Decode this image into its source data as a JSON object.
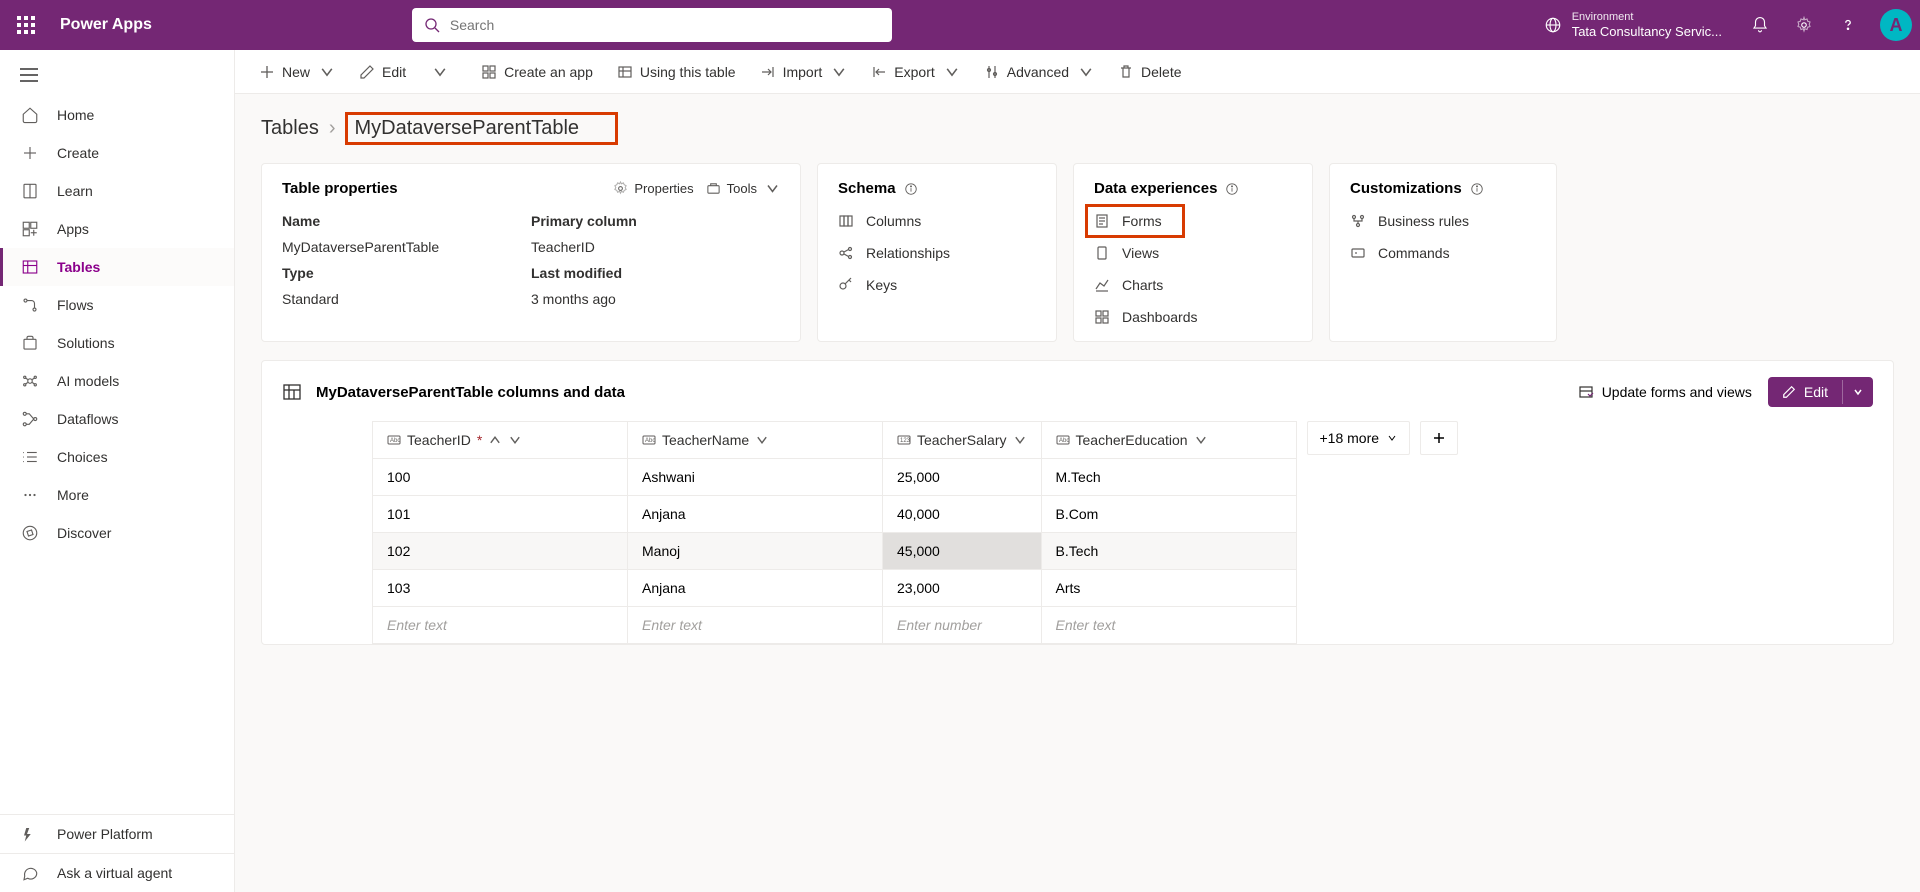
{
  "header": {
    "appName": "Power Apps",
    "searchPlaceholder": "Search",
    "envLabel": "Environment",
    "envName": "Tata Consultancy Servic...",
    "avatarInitial": "A"
  },
  "sidebar": {
    "items": [
      {
        "label": "Home"
      },
      {
        "label": "Create"
      },
      {
        "label": "Learn"
      },
      {
        "label": "Apps"
      },
      {
        "label": "Tables"
      },
      {
        "label": "Flows"
      },
      {
        "label": "Solutions"
      },
      {
        "label": "AI models"
      },
      {
        "label": "Dataflows"
      },
      {
        "label": "Choices"
      },
      {
        "label": "More"
      },
      {
        "label": "Discover"
      }
    ],
    "bottom": {
      "powerPlatform": "Power Platform",
      "ask": "Ask a virtual agent"
    }
  },
  "cmdbar": {
    "new": "New",
    "edit": "Edit",
    "createApp": "Create an app",
    "usingTable": "Using this table",
    "import": "Import",
    "export": "Export",
    "advanced": "Advanced",
    "delete": "Delete"
  },
  "breadcrumb": {
    "root": "Tables",
    "current": "MyDataverseParentTable"
  },
  "propsCard": {
    "title": "Table properties",
    "propertiesAction": "Properties",
    "toolsAction": "Tools",
    "labels": {
      "name": "Name",
      "primary": "Primary column",
      "type": "Type",
      "last": "Last modified"
    },
    "values": {
      "name": "MyDataverseParentTable",
      "primary": "TeacherID",
      "type": "Standard",
      "last": "3 months ago"
    }
  },
  "schemaCard": {
    "title": "Schema",
    "items": [
      "Columns",
      "Relationships",
      "Keys"
    ]
  },
  "deCard": {
    "title": "Data experiences",
    "items": [
      "Forms",
      "Views",
      "Charts",
      "Dashboards"
    ]
  },
  "custCard": {
    "title": "Customizations",
    "items": [
      "Business rules",
      "Commands"
    ]
  },
  "dataSection": {
    "title": "MyDataverseParentTable columns and data",
    "updateLink": "Update forms and views",
    "editBtn": "Edit",
    "moreCols": "+18 more",
    "headers": {
      "c1": "TeacherID",
      "c2": "TeacherName",
      "c3": "TeacherSalary",
      "c4": "TeacherEducation"
    },
    "rows": [
      {
        "id": "100",
        "name": "Ashwani",
        "salary": "25,000",
        "edu": "M.Tech"
      },
      {
        "id": "101",
        "name": "Anjana",
        "salary": "40,000",
        "edu": "B.Com"
      },
      {
        "id": "102",
        "name": "Manoj",
        "salary": "45,000",
        "edu": "B.Tech"
      },
      {
        "id": "103",
        "name": "Anjana",
        "salary": "23,000",
        "edu": "Arts"
      }
    ],
    "placeholders": {
      "text": "Enter text",
      "number": "Enter number"
    }
  }
}
